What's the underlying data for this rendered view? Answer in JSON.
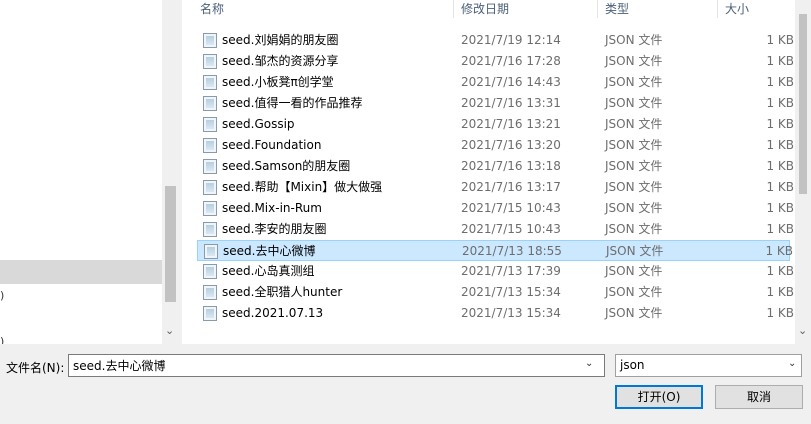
{
  "columns": {
    "name": "名称",
    "date": "修改日期",
    "type": "类型",
    "size": "大小"
  },
  "nav": {
    "paren1": ")",
    "paren2": ")"
  },
  "files": [
    {
      "name": "seed.刘娟娟的朋友圈",
      "date": "2021/7/19 12:14",
      "type": "JSON 文件",
      "size": "1 KB"
    },
    {
      "name": "seed.邹杰的资源分享",
      "date": "2021/7/16 17:28",
      "type": "JSON 文件",
      "size": "1 KB"
    },
    {
      "name": "seed.小板凳π创学堂",
      "date": "2021/7/16 14:43",
      "type": "JSON 文件",
      "size": "1 KB"
    },
    {
      "name": "seed.值得一看的作品推荐",
      "date": "2021/7/16 13:31",
      "type": "JSON 文件",
      "size": "1 KB"
    },
    {
      "name": "seed.Gossip",
      "date": "2021/7/16 13:21",
      "type": "JSON 文件",
      "size": "1 KB"
    },
    {
      "name": "seed.Foundation",
      "date": "2021/7/16 13:20",
      "type": "JSON 文件",
      "size": "1 KB"
    },
    {
      "name": "seed.Samson的朋友圈",
      "date": "2021/7/16 13:18",
      "type": "JSON 文件",
      "size": "1 KB"
    },
    {
      "name": "seed.帮助【Mixin】做大做强",
      "date": "2021/7/16 13:17",
      "type": "JSON 文件",
      "size": "1 KB"
    },
    {
      "name": "seed.Mix-in-Rum",
      "date": "2021/7/15 10:43",
      "type": "JSON 文件",
      "size": "1 KB"
    },
    {
      "name": "seed.李安的朋友圈",
      "date": "2021/7/15 10:43",
      "type": "JSON 文件",
      "size": "1 KB"
    },
    {
      "name": "seed.去中心微博",
      "date": "2021/7/13 18:55",
      "type": "JSON 文件",
      "size": "1 KB",
      "selected": true
    },
    {
      "name": "seed.心岛真测组",
      "date": "2021/7/13 17:39",
      "type": "JSON 文件",
      "size": "1 KB"
    },
    {
      "name": "seed.全职猎人hunter",
      "date": "2021/7/13 15:34",
      "type": "JSON 文件",
      "size": "1 KB"
    },
    {
      "name": "seed.2021.07.13",
      "date": "2021/7/13 15:34",
      "type": "JSON 文件",
      "size": "1 KB"
    }
  ],
  "bottom": {
    "filename_label": "文件名(N):",
    "filename_value": "seed.去中心微博",
    "filetype_value": "json",
    "open_label": "打开(O)",
    "cancel_label": "取消"
  },
  "icons": {
    "file": "json-file-icon",
    "dropdown": "chevron-down-icon",
    "scroll_down": "scroll-down-arrow-icon"
  }
}
